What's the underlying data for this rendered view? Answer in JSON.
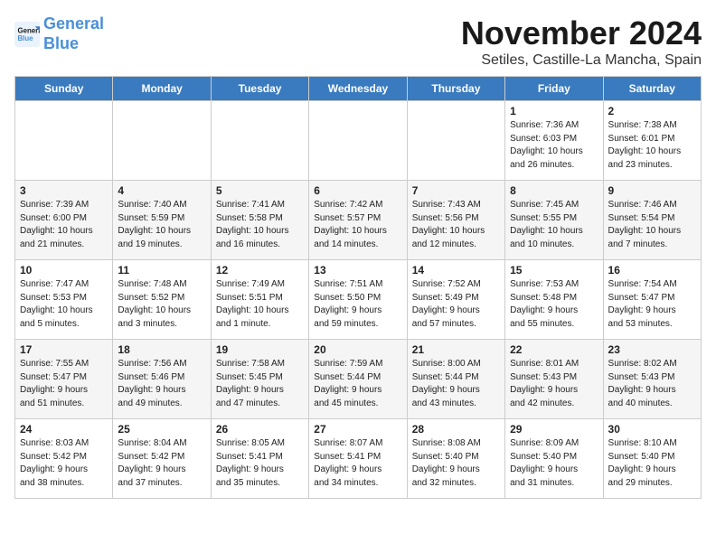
{
  "header": {
    "logo_line1": "General",
    "logo_line2": "Blue",
    "month_year": "November 2024",
    "location": "Setiles, Castille-La Mancha, Spain"
  },
  "weekdays": [
    "Sunday",
    "Monday",
    "Tuesday",
    "Wednesday",
    "Thursday",
    "Friday",
    "Saturday"
  ],
  "weeks": [
    [
      {
        "day": "",
        "info": ""
      },
      {
        "day": "",
        "info": ""
      },
      {
        "day": "",
        "info": ""
      },
      {
        "day": "",
        "info": ""
      },
      {
        "day": "",
        "info": ""
      },
      {
        "day": "1",
        "info": "Sunrise: 7:36 AM\nSunset: 6:03 PM\nDaylight: 10 hours\nand 26 minutes."
      },
      {
        "day": "2",
        "info": "Sunrise: 7:38 AM\nSunset: 6:01 PM\nDaylight: 10 hours\nand 23 minutes."
      }
    ],
    [
      {
        "day": "3",
        "info": "Sunrise: 7:39 AM\nSunset: 6:00 PM\nDaylight: 10 hours\nand 21 minutes."
      },
      {
        "day": "4",
        "info": "Sunrise: 7:40 AM\nSunset: 5:59 PM\nDaylight: 10 hours\nand 19 minutes."
      },
      {
        "day": "5",
        "info": "Sunrise: 7:41 AM\nSunset: 5:58 PM\nDaylight: 10 hours\nand 16 minutes."
      },
      {
        "day": "6",
        "info": "Sunrise: 7:42 AM\nSunset: 5:57 PM\nDaylight: 10 hours\nand 14 minutes."
      },
      {
        "day": "7",
        "info": "Sunrise: 7:43 AM\nSunset: 5:56 PM\nDaylight: 10 hours\nand 12 minutes."
      },
      {
        "day": "8",
        "info": "Sunrise: 7:45 AM\nSunset: 5:55 PM\nDaylight: 10 hours\nand 10 minutes."
      },
      {
        "day": "9",
        "info": "Sunrise: 7:46 AM\nSunset: 5:54 PM\nDaylight: 10 hours\nand 7 minutes."
      }
    ],
    [
      {
        "day": "10",
        "info": "Sunrise: 7:47 AM\nSunset: 5:53 PM\nDaylight: 10 hours\nand 5 minutes."
      },
      {
        "day": "11",
        "info": "Sunrise: 7:48 AM\nSunset: 5:52 PM\nDaylight: 10 hours\nand 3 minutes."
      },
      {
        "day": "12",
        "info": "Sunrise: 7:49 AM\nSunset: 5:51 PM\nDaylight: 10 hours\nand 1 minute."
      },
      {
        "day": "13",
        "info": "Sunrise: 7:51 AM\nSunset: 5:50 PM\nDaylight: 9 hours\nand 59 minutes."
      },
      {
        "day": "14",
        "info": "Sunrise: 7:52 AM\nSunset: 5:49 PM\nDaylight: 9 hours\nand 57 minutes."
      },
      {
        "day": "15",
        "info": "Sunrise: 7:53 AM\nSunset: 5:48 PM\nDaylight: 9 hours\nand 55 minutes."
      },
      {
        "day": "16",
        "info": "Sunrise: 7:54 AM\nSunset: 5:47 PM\nDaylight: 9 hours\nand 53 minutes."
      }
    ],
    [
      {
        "day": "17",
        "info": "Sunrise: 7:55 AM\nSunset: 5:47 PM\nDaylight: 9 hours\nand 51 minutes."
      },
      {
        "day": "18",
        "info": "Sunrise: 7:56 AM\nSunset: 5:46 PM\nDaylight: 9 hours\nand 49 minutes."
      },
      {
        "day": "19",
        "info": "Sunrise: 7:58 AM\nSunset: 5:45 PM\nDaylight: 9 hours\nand 47 minutes."
      },
      {
        "day": "20",
        "info": "Sunrise: 7:59 AM\nSunset: 5:44 PM\nDaylight: 9 hours\nand 45 minutes."
      },
      {
        "day": "21",
        "info": "Sunrise: 8:00 AM\nSunset: 5:44 PM\nDaylight: 9 hours\nand 43 minutes."
      },
      {
        "day": "22",
        "info": "Sunrise: 8:01 AM\nSunset: 5:43 PM\nDaylight: 9 hours\nand 42 minutes."
      },
      {
        "day": "23",
        "info": "Sunrise: 8:02 AM\nSunset: 5:43 PM\nDaylight: 9 hours\nand 40 minutes."
      }
    ],
    [
      {
        "day": "24",
        "info": "Sunrise: 8:03 AM\nSunset: 5:42 PM\nDaylight: 9 hours\nand 38 minutes."
      },
      {
        "day": "25",
        "info": "Sunrise: 8:04 AM\nSunset: 5:42 PM\nDaylight: 9 hours\nand 37 minutes."
      },
      {
        "day": "26",
        "info": "Sunrise: 8:05 AM\nSunset: 5:41 PM\nDaylight: 9 hours\nand 35 minutes."
      },
      {
        "day": "27",
        "info": "Sunrise: 8:07 AM\nSunset: 5:41 PM\nDaylight: 9 hours\nand 34 minutes."
      },
      {
        "day": "28",
        "info": "Sunrise: 8:08 AM\nSunset: 5:40 PM\nDaylight: 9 hours\nand 32 minutes."
      },
      {
        "day": "29",
        "info": "Sunrise: 8:09 AM\nSunset: 5:40 PM\nDaylight: 9 hours\nand 31 minutes."
      },
      {
        "day": "30",
        "info": "Sunrise: 8:10 AM\nSunset: 5:40 PM\nDaylight: 9 hours\nand 29 minutes."
      }
    ]
  ]
}
